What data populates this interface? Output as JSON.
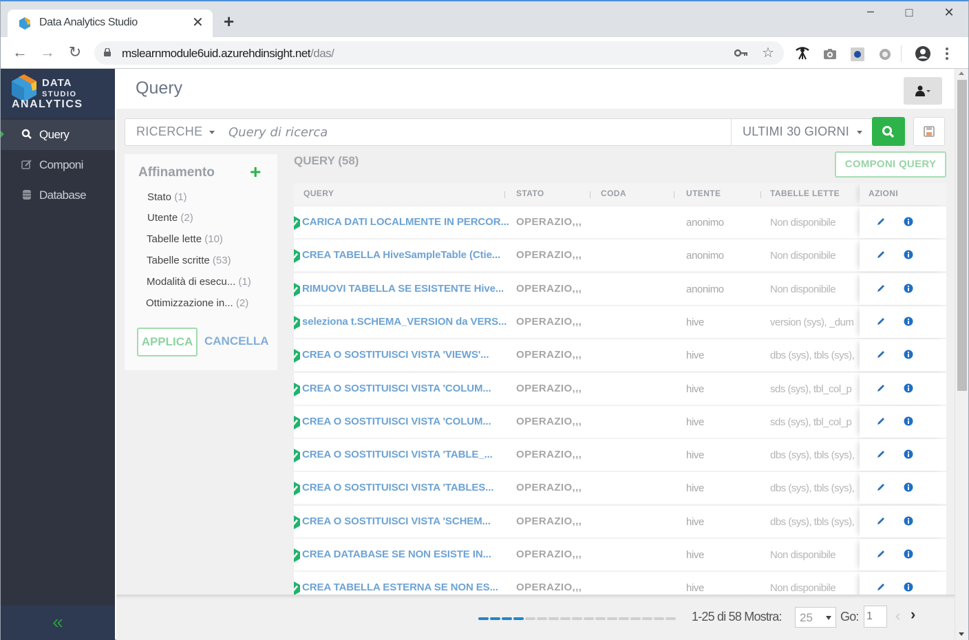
{
  "browser": {
    "tab_title": "Data Analytics Studio",
    "url_host": "mslearnmodule6uid.azurehdinsight.net",
    "url_path": "/das/",
    "window_controls": {
      "minimize": "–",
      "maximize": "□",
      "close": "✕"
    },
    "nav": {
      "back": "←",
      "forward": "→",
      "reload": "↻"
    },
    "new_tab": "+",
    "tab_close": "✕"
  },
  "sidebar": {
    "logo": {
      "line1": "DATA",
      "line2": "STUDIO",
      "line3": "ANALYTICS"
    },
    "items": [
      {
        "label": "Query",
        "icon": "search-icon",
        "active": true
      },
      {
        "label": "Componi",
        "icon": "edit-icon",
        "active": false
      },
      {
        "label": "Database",
        "icon": "database-icon",
        "active": false
      }
    ],
    "collapse_icon": "«"
  },
  "header": {
    "title": "Query"
  },
  "search": {
    "saved_searches_label": "RICERCHE",
    "placeholder": "Query di ricerca",
    "value": "",
    "time_range": "ULTIMI 30 GIORNI"
  },
  "refine": {
    "title": "Affinamento",
    "add_icon": "+",
    "facets": [
      {
        "label": "Stato",
        "count": "(1)"
      },
      {
        "label": "Utente",
        "count": "(2)"
      },
      {
        "label": "Tabelle lette",
        "count": "(10)"
      },
      {
        "label": "Tabelle scritte",
        "count": "(53)"
      },
      {
        "label": "Modalità di esecu...",
        "count": "(1)"
      },
      {
        "label": "Ottimizzazione in...",
        "count": "(2)"
      }
    ],
    "apply_label": "APPLICA",
    "cancel_label": "CANCELLA"
  },
  "results": {
    "title": "QUERY (58)",
    "compose_label": "COMPONI QUERY",
    "columns": [
      "QUERY",
      "STATO",
      "CODA",
      "UTENTE",
      "TABELLE LETTE",
      "AZIONI"
    ],
    "rows": [
      {
        "query": "CARICA DATI LOCALMENTE IN PERCOR...",
        "state": "OPERAZIO,,,",
        "queue": "",
        "user": "anonimo",
        "tables": "Non disponibile"
      },
      {
        "query": "CREA TABELLA HiveSampleTable (Ctie...",
        "state": "OPERAZIO,,,",
        "queue": "",
        "user": "anonimo",
        "tables": "Non disponibile"
      },
      {
        "query": "RIMUOVI TABELLA SE ESISTENTE Hive...",
        "state": "OPERAZIO,,,",
        "queue": "",
        "user": "anonimo",
        "tables": "Non disponibile"
      },
      {
        "query": "seleziona t.SCHEMA_VERSION da VERS...",
        "state": "OPERAZIO,,,",
        "queue": "",
        "user": "hive",
        "tables": "version (sys), _dum"
      },
      {
        "query": "CREA O SOSTITUISCI VISTA 'VIEWS'...",
        "state": "OPERAZIO,,,",
        "queue": "",
        "user": "hive",
        "tables": "dbs (sys), tbls (sys),"
      },
      {
        "query": "CREA O SOSTITUISCI VISTA 'COLUM...",
        "state": "OPERAZIO,,,",
        "queue": "",
        "user": "hive",
        "tables": "sds (sys), tbl_col_p"
      },
      {
        "query": "CREA O SOSTITUISCI VISTA 'COLUM...",
        "state": "OPERAZIO,,,",
        "queue": "",
        "user": "hive",
        "tables": "sds (sys), tbl_col_p"
      },
      {
        "query": "CREA O SOSTITUISCI VISTA 'TABLE_...",
        "state": "OPERAZIO,,,",
        "queue": "",
        "user": "hive",
        "tables": "dbs (sys), tbls (sys),"
      },
      {
        "query": "CREA O SOSTITUISCI VISTA 'TABLES...",
        "state": "OPERAZIO,,,",
        "queue": "",
        "user": "hive",
        "tables": "dbs (sys), tbls (sys),"
      },
      {
        "query": "CREA O SOSTITUISCI VISTA 'SCHEM...",
        "state": "OPERAZIO,,,",
        "queue": "",
        "user": "hive",
        "tables": "dbs (sys), tbls (sys),"
      },
      {
        "query": "CREA DATABASE SE NON ESISTE IN...",
        "state": "OPERAZIO,,,",
        "queue": "",
        "user": "hive",
        "tables": "Non disponibile"
      },
      {
        "query": "CREA TABELLA ESTERNA SE NON ES...",
        "state": "OPERAZIO,,,",
        "queue": "",
        "user": "hive",
        "tables": "Non disponibile"
      }
    ]
  },
  "pagination": {
    "progress_segments_total": 17,
    "progress_segments_filled": 4,
    "range_text": "1-25 di 58",
    "show_label": "Mostra:",
    "page_size": "25",
    "go_label": "Go:",
    "go_value": "1",
    "prev": "‹",
    "next": "›"
  },
  "colors": {
    "accent_green": "#2db34a",
    "link_blue": "#6da3d4",
    "sidebar_bg": "#2f3440",
    "progress_blue": "#1f87c8"
  }
}
